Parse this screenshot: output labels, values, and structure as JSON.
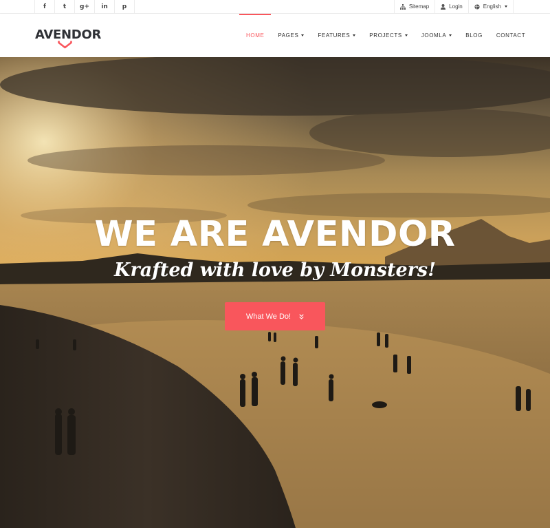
{
  "social": {
    "icons": [
      "facebook-icon",
      "twitter-icon",
      "google-plus-icon",
      "linkedin-icon",
      "pinterest-icon"
    ],
    "glyphs": [
      "f",
      "t",
      "g+",
      "in",
      "p"
    ]
  },
  "utility": {
    "sitemap": "Sitemap",
    "login": "Login",
    "language": "English"
  },
  "brand": {
    "logo_text": "AVENDOR",
    "accent": "#f9565c",
    "dark": "#2f3136"
  },
  "nav": {
    "items": [
      {
        "label": "HOME",
        "dropdown": false,
        "active": true
      },
      {
        "label": "PAGES",
        "dropdown": true,
        "active": false
      },
      {
        "label": "FEATURES",
        "dropdown": true,
        "active": false
      },
      {
        "label": "PROJECTS",
        "dropdown": true,
        "active": false
      },
      {
        "label": "JOOMLA",
        "dropdown": true,
        "active": false
      },
      {
        "label": "BLOG",
        "dropdown": false,
        "active": false
      },
      {
        "label": "CONTACT",
        "dropdown": false,
        "active": false
      }
    ]
  },
  "hero": {
    "title": "WE ARE AVENDOR",
    "subtitle": "Krafted with love by Monsters!",
    "cta_label": "What We Do!",
    "cta_icon": "double-chevron-down-icon"
  }
}
